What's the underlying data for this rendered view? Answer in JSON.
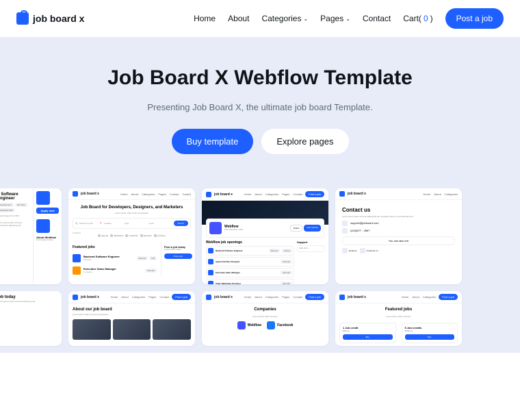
{
  "brand": "job board x",
  "nav": {
    "home": "Home",
    "about": "About",
    "categories": "Categories",
    "pages": "Pages",
    "contact": "Contact",
    "cart_label": "Cart(",
    "cart_count": "0",
    "cart_close": ")"
  },
  "post_job": "Post a job",
  "hero": {
    "title": "Job Board X Webflow Template",
    "subtitle": "Presenting Job Board X, the ultimate job board Template.",
    "buy": "Buy template",
    "explore": "Explore pages"
  },
  "gallery": {
    "mini_brand": "job board x",
    "mini_nav": [
      "Home",
      "About",
      "Categories",
      "Pages",
      "Contact",
      "Cart(0)"
    ],
    "mini_post": "Post a job",
    "card1": {
      "apply": "Apply now",
      "role": "d Software Engineer",
      "about": "About Webflow"
    },
    "card2": {
      "title": "Job Board for Developers, Designers, and Marketers",
      "search": "Search for jobs",
      "location": "Location",
      "type": "Type",
      "level": "Level",
      "search_btn": "Search",
      "trending": "Trending",
      "cats": [
        "gaming",
        "application",
        "enterprise",
        "business",
        "company"
      ],
      "featured": "Featured jobs",
      "jobs": [
        "Backend Software Engineer",
        "Executive Sales Manager"
      ]
    },
    "card3": {
      "company": "Webflow",
      "visit": "Visit website",
      "openings": "Webflow job openings",
      "jobs": [
        "Backend Software Engineer",
        "Agent Interface Designer",
        "Executive Sales Manager",
        "Video Marketing Producer"
      ]
    },
    "card4": {
      "title": "Contact us",
      "email": "support@jobboard.com",
      "phone": "(415)877 - 4567",
      "also": "You can also em"
    },
    "card5": "job today",
    "card6": "About our job board",
    "card7": {
      "title": "Companies",
      "comps": [
        "Webflow",
        "Facebook"
      ]
    },
    "card8": {
      "title": "Featured jobs",
      "credits": [
        "1 Job credit",
        "5 Job credits"
      ]
    },
    "sidebar": {
      "post_today": "Post a job today",
      "support": "Support"
    }
  }
}
